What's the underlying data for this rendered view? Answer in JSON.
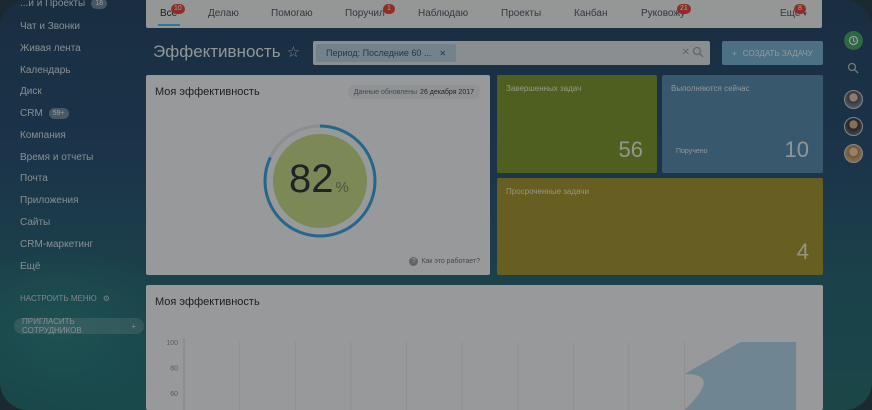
{
  "sidebar": {
    "items": [
      {
        "label": "...и и Проекты",
        "badge": "18"
      },
      {
        "label": "Чат и Звонки"
      },
      {
        "label": "Живая лента"
      },
      {
        "label": "Календарь"
      },
      {
        "label": "Диск"
      },
      {
        "label": "CRM",
        "badge": "59+"
      },
      {
        "label": "Компания"
      },
      {
        "label": "Время и отчеты"
      },
      {
        "label": "Почта"
      },
      {
        "label": "Приложения"
      },
      {
        "label": "Сайты"
      },
      {
        "label": "CRM-маркетинг"
      },
      {
        "label": "Ещё"
      }
    ],
    "settings_label": "НАСТРОИТЬ МЕНЮ",
    "invite_label": "ПРИГЛАСИТЬ СОТРУДНИКОВ"
  },
  "tabs": [
    {
      "label": "Все",
      "count": "10",
      "active": true
    },
    {
      "label": "Делаю"
    },
    {
      "label": "Помогаю"
    },
    {
      "label": "Поручил",
      "count": "1"
    },
    {
      "label": "Наблюдаю"
    },
    {
      "label": "Проекты"
    },
    {
      "label": "Канбан"
    },
    {
      "label": "Руковожу",
      "count": "21"
    },
    {
      "label": "Ещё",
      "count": "8"
    }
  ],
  "page": {
    "title": "Эффективность",
    "filter_chip": "Период: Последние 60 ...",
    "create_button": "СОЗДАТЬ ЗАДАЧУ"
  },
  "efficiency_card": {
    "title": "Моя эффективность",
    "date_label": "Данные обновлены",
    "date_value": "26 декабря 2017",
    "value": "82",
    "unit": "%",
    "progress_fraction": 0.82,
    "help_link": "Как это работает?"
  },
  "tiles": {
    "completed": {
      "label": "Завершенных задач",
      "value": "56"
    },
    "in_progress": {
      "label": "Выполняются сейчас",
      "sub": "Поручено",
      "value": "10"
    },
    "overdue": {
      "label": "Просроченные задачи",
      "value": "4"
    }
  },
  "chart_card": {
    "title": "Моя эффективность"
  },
  "chart_data": {
    "type": "area",
    "yticks": [
      "100",
      "80",
      "60"
    ],
    "ylim": [
      0,
      100
    ],
    "series": [
      {
        "values": [
          null,
          null,
          null,
          null,
          null,
          null,
          null,
          null,
          null,
          75,
          100,
          100
        ]
      }
    ],
    "grid": true
  },
  "colors": {
    "accent": "#3bc8f5",
    "tile_green": "#7f9a35",
    "tile_blue": "#5b8fb0",
    "tile_yellow": "#a59a36",
    "badge_red": "#e84b3c"
  }
}
